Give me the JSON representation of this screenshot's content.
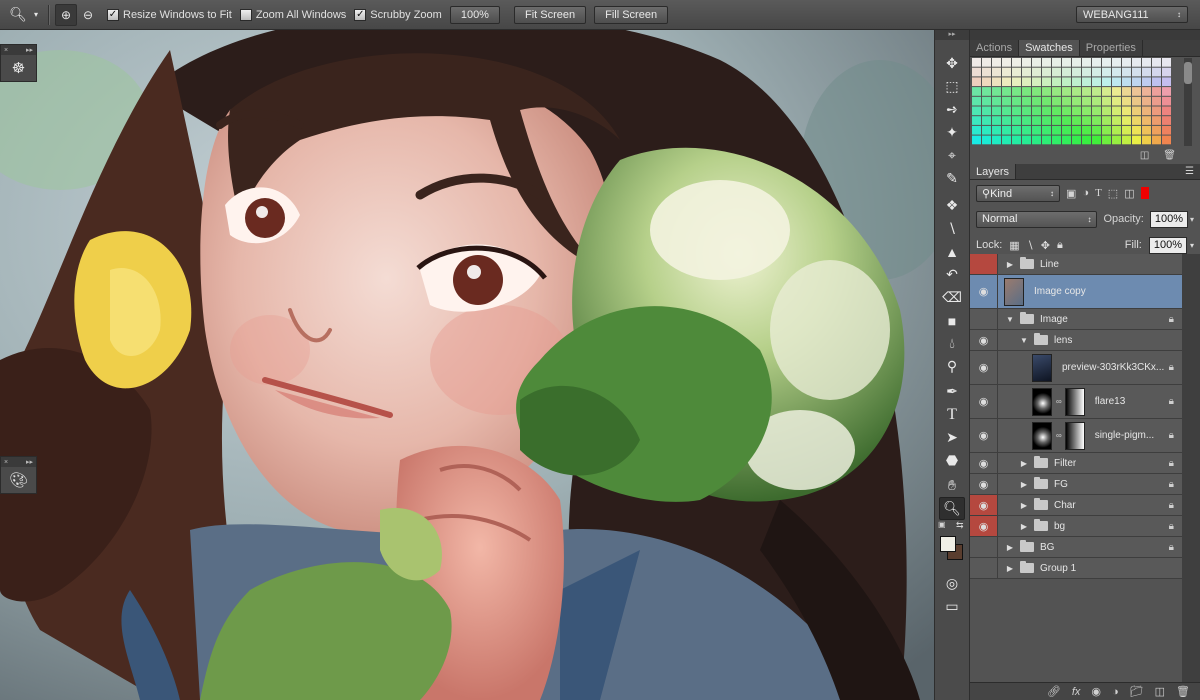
{
  "optbar": {
    "resize_label": "Resize Windows to Fit",
    "zoom_all_label": "Zoom All Windows",
    "scrubby_label": "Scrubby Zoom",
    "zoom_value": "100%",
    "fit_screen": "Fit Screen",
    "fill_screen": "Fill Screen",
    "workspace": "WEBANG111"
  },
  "panel_tabs": [
    "Actions",
    "Swatches",
    "Properties"
  ],
  "layers_tab": "Layers",
  "layers_controls": {
    "filter_kind": "Kind",
    "blend_mode": "Normal",
    "opacity_label": "Opacity:",
    "opacity_value": "100%",
    "lock_label": "Lock:",
    "fill_label": "Fill:",
    "fill_value": "100%"
  },
  "layers": [
    {
      "name": "Line",
      "type": "group",
      "visible": false,
      "color": "red",
      "locked": false,
      "indent": 0,
      "expanded": false
    },
    {
      "name": "Image copy",
      "type": "layer",
      "visible": true,
      "color": "none",
      "locked": false,
      "indent": 0,
      "selected": true
    },
    {
      "name": "Image",
      "type": "group",
      "visible": false,
      "color": "none",
      "locked": true,
      "indent": 0,
      "expanded": true
    },
    {
      "name": "lens",
      "type": "group",
      "visible": true,
      "color": "none",
      "locked": false,
      "indent": 1,
      "expanded": true
    },
    {
      "name": "preview-303rKk3CKx...",
      "type": "layer",
      "visible": true,
      "color": "none",
      "locked": true,
      "indent": 2
    },
    {
      "name": "flare13",
      "type": "masked",
      "visible": true,
      "color": "none",
      "locked": true,
      "indent": 2
    },
    {
      "name": "single-pigm...",
      "type": "masked",
      "visible": true,
      "color": "none",
      "locked": true,
      "indent": 2
    },
    {
      "name": "Filter",
      "type": "group",
      "visible": true,
      "color": "none",
      "locked": true,
      "indent": 1
    },
    {
      "name": "FG",
      "type": "group",
      "visible": true,
      "color": "none",
      "locked": true,
      "indent": 1
    },
    {
      "name": "Char",
      "type": "group",
      "visible": true,
      "color": "red",
      "locked": true,
      "indent": 1
    },
    {
      "name": "bg",
      "type": "group",
      "visible": true,
      "color": "red",
      "locked": true,
      "indent": 1
    },
    {
      "name": "BG",
      "type": "group",
      "visible": false,
      "color": "none",
      "locked": true,
      "indent": 0
    },
    {
      "name": "Group 1",
      "type": "group",
      "visible": false,
      "color": "none",
      "locked": false,
      "indent": 0
    }
  ],
  "colors": {
    "foreground": "#f0efe6",
    "background": "#5a3d2e",
    "accent_selected": "#6d8bb0",
    "label_red": "#b5483f"
  },
  "tool_icons": [
    "move-tool-icon",
    "marquee-tool-icon",
    "lasso-tool-icon",
    "magic-wand-icon",
    "crop-tool-icon",
    "eyedropper-icon",
    "healing-brush-icon",
    "brush-tool-icon",
    "clone-stamp-icon",
    "history-brush-icon",
    "eraser-icon",
    "gradient-tool-icon",
    "blur-tool-icon",
    "dodge-tool-icon",
    "pen-tool-icon",
    "type-tool-icon",
    "path-selection-icon",
    "shape-tool-icon",
    "hand-tool-icon",
    "zoom-tool-icon"
  ]
}
